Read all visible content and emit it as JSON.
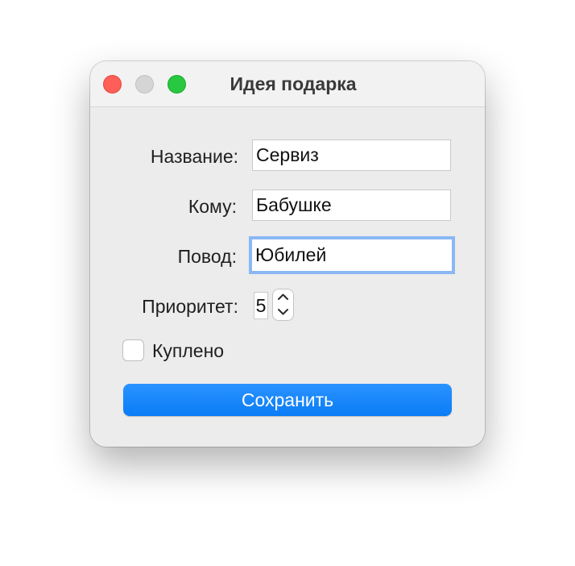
{
  "window": {
    "title": "Идея подарка"
  },
  "form": {
    "name_label": "Название:",
    "name_value": "Сервиз",
    "recipient_label": "Кому:",
    "recipient_value": "Бабушке",
    "occasion_label": "Повод:",
    "occasion_value": "Юбилей",
    "priority_label": "Приоритет:",
    "priority_value": "5",
    "bought_label": "Куплено",
    "bought_checked": false,
    "save_label": "Сохранить"
  },
  "colors": {
    "close": "#ff5f57",
    "minimize": "#d5d5d5",
    "maximize": "#28c840",
    "accent": "#0a7cf6",
    "focus_ring": "#8ab8f4"
  },
  "icons": {
    "stepper_up": "chevron-up-icon",
    "stepper_down": "chevron-down-icon"
  }
}
